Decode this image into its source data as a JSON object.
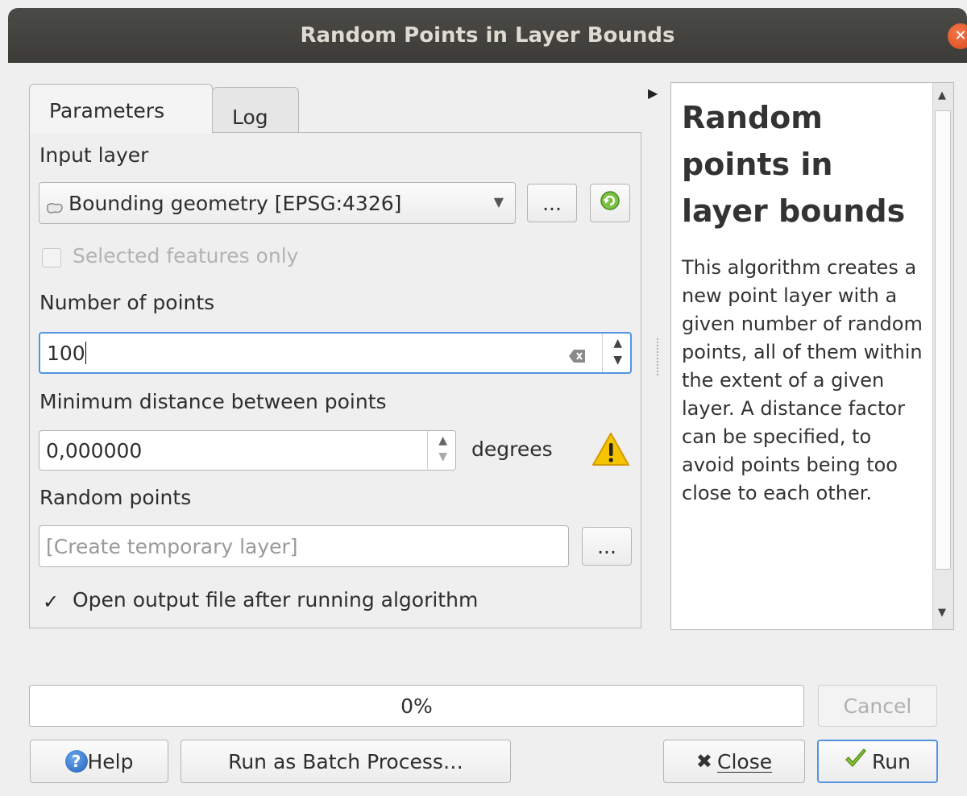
{
  "window": {
    "title": "Random Points in Layer Bounds"
  },
  "tabs": [
    {
      "label": "Parameters"
    },
    {
      "label": "Log"
    }
  ],
  "params": {
    "input_layer_label": "Input layer",
    "input_layer_value": "Bounding geometry [EPSG:4326]",
    "browse_label": "...",
    "selected_only_label": "Selected features only",
    "num_points_label": "Number of points",
    "num_points_value": "100",
    "min_distance_label": "Minimum distance between points",
    "min_distance_value": "0,000000",
    "distance_unit": "degrees",
    "random_points_label": "Random points",
    "output_placeholder": "[Create temporary layer]",
    "output_browse_label": "...",
    "open_output_label": "Open output file after running algorithm",
    "open_output_checked": true
  },
  "help": {
    "title": "Random points in layer bounds",
    "body": "This algorithm creates a new point layer with a given number of random points, all of them within the extent of a given layer. A distance factor can be specified, to avoid points being too close to each other."
  },
  "progress": {
    "text": "0%",
    "value": 0
  },
  "buttons": {
    "cancel": "Cancel",
    "help": "Help",
    "batch": "Run as Batch Process…",
    "close": "Close",
    "run": "Run"
  },
  "colors": {
    "accent": "#2f7bd0",
    "titlebar": "#3c3b37",
    "warning": "#f5c400"
  }
}
